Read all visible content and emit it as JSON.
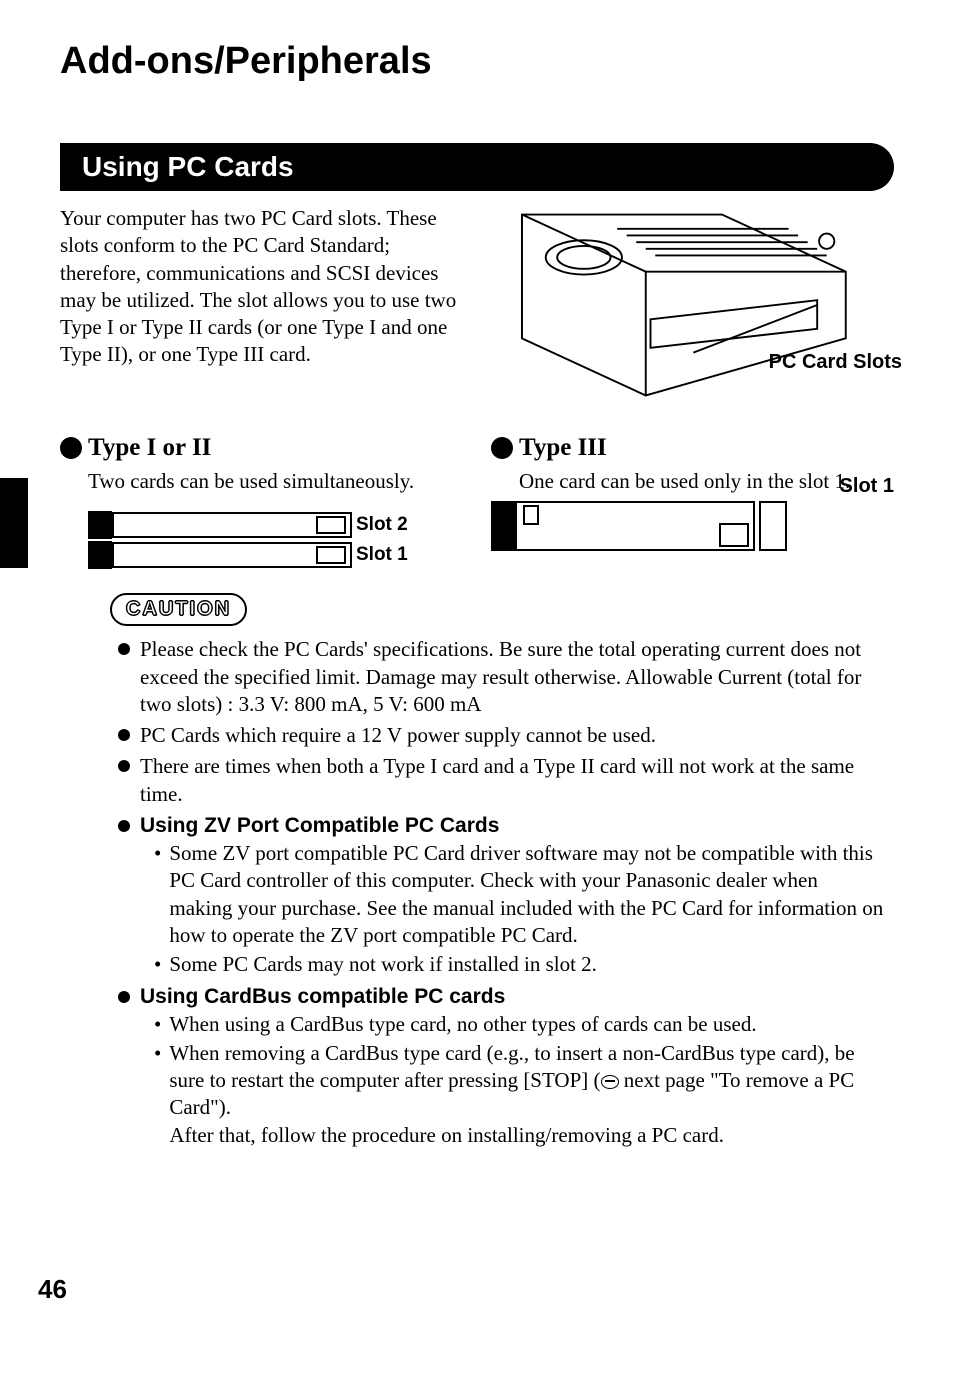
{
  "page_title": "Add-ons/Peripherals",
  "section_heading": "Using PC Cards",
  "intro_paragraph": "Your computer has two PC Card slots. These slots conform to the PC Card Standard; therefore, communications and SCSI devices may be utilized. The slot allows you to use two Type I or Type II cards (or one Type I and one Type II), or one Type III card.",
  "laptop_callout": "PC Card Slots",
  "type_a": {
    "heading": "Type I or II",
    "body": "Two cards can be used simultaneously.",
    "slot2_label": "Slot 2",
    "slot1_label": "Slot 1"
  },
  "type_b": {
    "heading": "Type III",
    "body": "One card can be used only in the slot 1.",
    "slot1_label": "Slot 1"
  },
  "caution_label": "CAUTION",
  "cautions": {
    "c1": "Please check the PC Cards' specifications. Be sure the total operating current does not exceed the specified limit. Damage may result otherwise. Allowable Current (total for two slots) : 3.3 V: 800 mA, 5 V: 600 mA",
    "c2": "PC Cards which require a 12 V power supply cannot be used.",
    "c3": "There are times when both a Type I card and a Type II card will not work at the same time.",
    "h_zv": "Using ZV Port Compatible PC Cards",
    "zv1": "Some ZV port compatible PC Card driver software may not be compatible with this PC Card controller of this computer. Check with your Panasonic dealer when making your purchase. See the manual included with the PC Card for information on how to operate the ZV port compatible PC Card.",
    "zv2": "Some PC Cards may not work if installed in slot 2.",
    "h_cb": "Using CardBus compatible PC cards",
    "cb1": "When using a CardBus type card, no other types of cards can be used.",
    "cb2a": "When removing a CardBus type card (e.g., to insert a non-CardBus type card), be sure to restart the computer after pressing [STOP] (",
    "cb2b": " next page \"To remove a PC Card\").",
    "cb3": "After that, follow the procedure on installing/removing a PC card."
  },
  "page_number": "46"
}
